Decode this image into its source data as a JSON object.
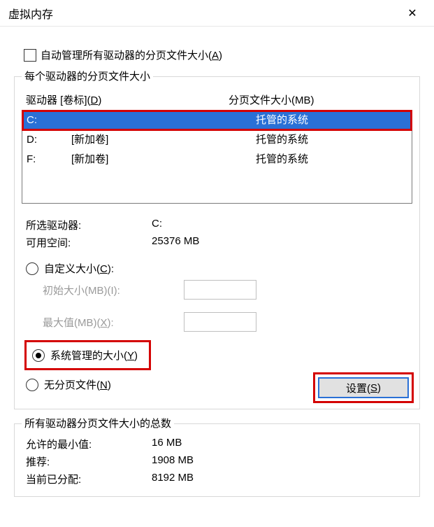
{
  "window": {
    "title": "虚拟内存",
    "close": "✕"
  },
  "auto_manage": {
    "label_pre": "自动管理所有驱动器的分页文件大小(",
    "accel": "A",
    "label_post": ")",
    "checked": false
  },
  "group1": {
    "title": "每个驱动器的分页文件大小",
    "header_drive": "驱动器 [卷标](",
    "header_drive_accel": "D",
    "header_drive_post": ")",
    "header_size": "分页文件大小(MB)",
    "rows": [
      {
        "letter": "C:",
        "label": "",
        "size": "托管的系统",
        "selected": true
      },
      {
        "letter": "D:",
        "label": "[新加卷]",
        "size": "托管的系统",
        "selected": false
      },
      {
        "letter": "F:",
        "label": "[新加卷]",
        "size": "托管的系统",
        "selected": false
      }
    ],
    "selected_drive_label": "所选驱动器:",
    "selected_drive_value": "C:",
    "free_space_label": "可用空间:",
    "free_space_value": "25376 MB",
    "custom_size_label_pre": "自定义大小(",
    "custom_size_accel": "C",
    "custom_size_label_post": "):",
    "initial_label": "初始大小(MB)(I):",
    "max_label_pre": "最大值(MB)(",
    "max_accel": "X",
    "max_label_post": "):",
    "system_managed_label_pre": "系统管理的大小(",
    "system_managed_accel": "Y",
    "system_managed_label_post": ")",
    "no_paging_label_pre": "无分页文件(",
    "no_paging_accel": "N",
    "no_paging_label_post": ")",
    "set_button_pre": "设置(",
    "set_button_accel": "S",
    "set_button_post": ")"
  },
  "group2": {
    "title": "所有驱动器分页文件大小的总数",
    "min_label": "允许的最小值:",
    "min_value": "16 MB",
    "rec_label": "推荐:",
    "rec_value": "1908 MB",
    "cur_label": "当前已分配:",
    "cur_value": "8192 MB"
  }
}
